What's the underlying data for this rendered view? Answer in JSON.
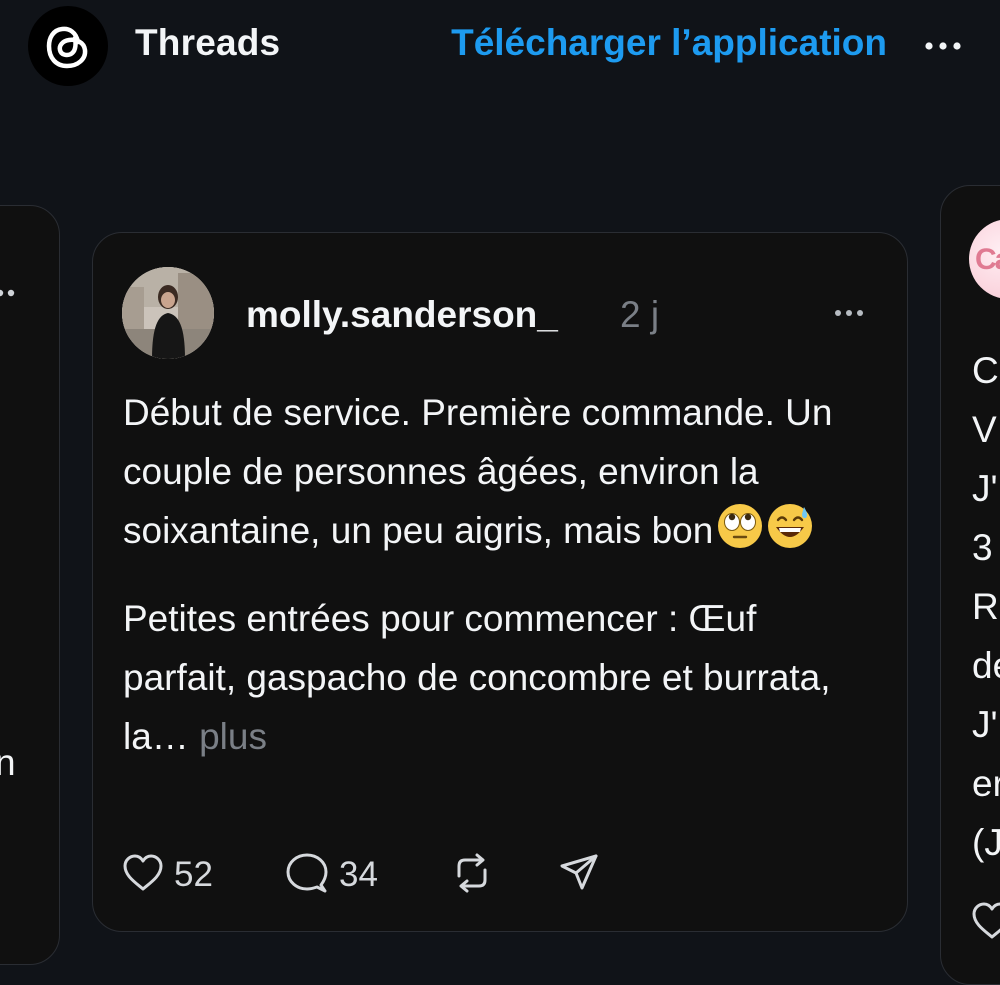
{
  "header": {
    "app_name": "Threads",
    "download_label": "Télécharger l’application",
    "logo_icon": "threads-logo-icon",
    "more_icon": "more-horizontal-icon"
  },
  "post": {
    "username": "molly.sanderson_",
    "time_ago": "2 j",
    "paragraph_1": "Début de service. Première commande. Un couple de personnes âgées, environ la soixantaine, un peu aigris, mais bon",
    "paragraph_1_emojis": [
      "face-with-rolling-eyes-emoji",
      "grinning-face-with-sweat-emoji"
    ],
    "paragraph_2": "Petites entrées pour commencer : Œuf parfait, gaspacho de concombre et burrata, la…",
    "more_label": "plus",
    "likes": "52",
    "replies": "34",
    "icons": [
      "heart-icon",
      "comment-icon",
      "repost-icon",
      "share-icon"
    ]
  },
  "left_peek": {
    "visible_text": "n"
  },
  "right_peek": {
    "avatar_text": "Ca",
    "lines": [
      "C",
      "V",
      "J'",
      "3",
      "Re",
      "de",
      "J'",
      "er",
      "(J"
    ]
  },
  "colors": {
    "background": "#101318",
    "card": "#101010",
    "accent": "#1d9bf0",
    "muted": "#7a7f86"
  }
}
